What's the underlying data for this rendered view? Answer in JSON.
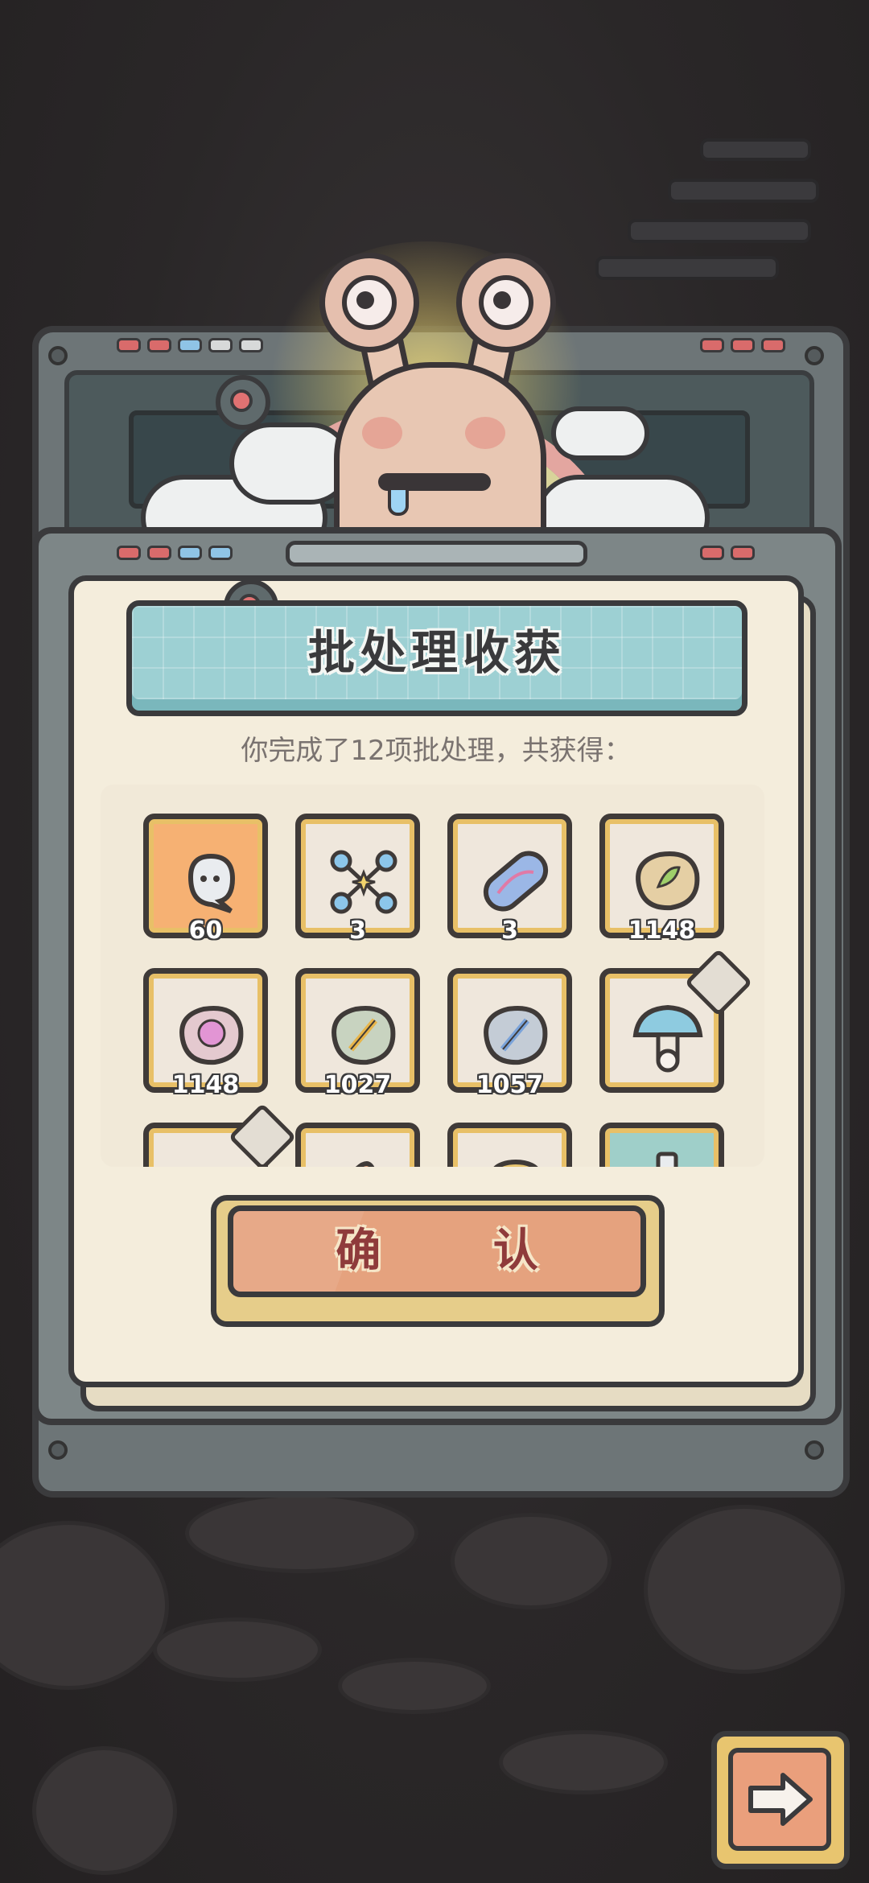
{
  "dialog": {
    "title": "批处理收获",
    "summary": "你完成了12项批处理，共获得：",
    "confirm_label": "确 认"
  },
  "rewards": [
    {
      "icon": "ghost-spirit-icon",
      "count": "60",
      "bg": "orange"
    },
    {
      "icon": "constellation-network-icon",
      "count": "3",
      "bg": "plain"
    },
    {
      "icon": "rune-capsule-icon",
      "count": "3",
      "bg": "plain"
    },
    {
      "icon": "leaf-rune-stone-icon",
      "count": "1148",
      "bg": "plain"
    },
    {
      "icon": "pink-rune-stone-icon",
      "count": "1148",
      "bg": "plain"
    },
    {
      "icon": "green-sword-stone-icon",
      "count": "1027",
      "bg": "plain"
    },
    {
      "icon": "blue-sword-stone-icon",
      "count": "1057",
      "bg": "plain"
    },
    {
      "icon": "blue-mushroom-icon",
      "count": "",
      "bg": "plain"
    },
    {
      "icon": "blue-item-partial-icon",
      "count": "",
      "bg": "plain"
    },
    {
      "icon": "orange-item-partial-icon",
      "count": "",
      "bg": "plain"
    },
    {
      "icon": "yellow-item-partial-icon",
      "count": "",
      "bg": "plain"
    },
    {
      "icon": "bottle-item-partial-icon",
      "count": "",
      "bg": "teal"
    }
  ],
  "colors": {
    "banner": "#9dd0d3",
    "paper": "#f4eddc",
    "confirm": "#e5a27e",
    "highlight_tile": "#f6b173",
    "outline": "#3a3a3c"
  },
  "nav": {
    "next_icon": "right-arrow-icon"
  }
}
